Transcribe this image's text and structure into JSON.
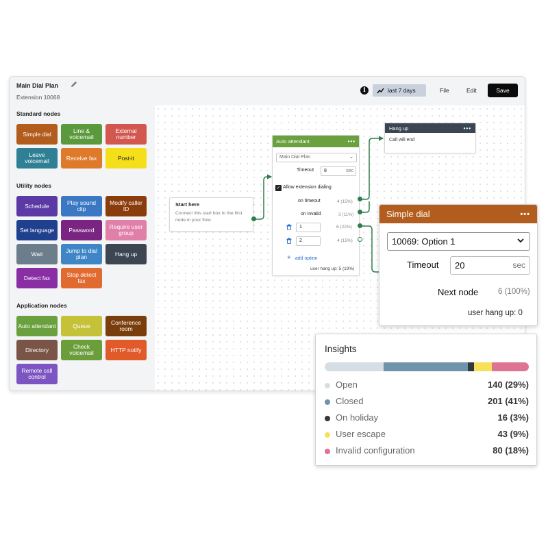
{
  "header": {
    "title": "Main Dial Plan",
    "subtitle": "Extension 10068",
    "range_label": "last 7 days",
    "menu_file": "File",
    "menu_edit": "Edit",
    "save_label": "Save"
  },
  "palette": {
    "standard_title": "Standard nodes",
    "utility_title": "Utility nodes",
    "application_title": "Application nodes",
    "standard": [
      {
        "label": "Simple dial",
        "color": "#b25d1d"
      },
      {
        "label": "Line & voicemail",
        "color": "#5b9a3c"
      },
      {
        "label": "External number",
        "color": "#d2584f"
      },
      {
        "label": "Leave voicemail",
        "color": "#2f7f95"
      },
      {
        "label": "Receive fax",
        "color": "#e07a2b"
      },
      {
        "label": "Post-it",
        "color": "#f4df1a",
        "text_color": "#222222"
      }
    ],
    "utility": [
      {
        "label": "Schedule",
        "color": "#5c3aa6"
      },
      {
        "label": "Play sound clip",
        "color": "#3a78c4"
      },
      {
        "label": "Modify caller ID",
        "color": "#8b3c0c"
      },
      {
        "label": "Set language",
        "color": "#1f3f8f"
      },
      {
        "label": "Password",
        "color": "#7a2582"
      },
      {
        "label": "Require user group",
        "color": "#e07fa8"
      },
      {
        "label": "Wait",
        "color": "#6c7e8c"
      },
      {
        "label": "Jump to dial plan",
        "color": "#3f86c6"
      },
      {
        "label": "Hang up",
        "color": "#3b4652"
      },
      {
        "label": "Detect fax",
        "color": "#8a2fa3"
      },
      {
        "label": "Stop detect fax",
        "color": "#e06a30"
      }
    ],
    "application": [
      {
        "label": "Auto attendant",
        "color": "#6aa13e"
      },
      {
        "label": "Queue",
        "color": "#c5c23a"
      },
      {
        "label": "Conference room",
        "color": "#7a3e0c"
      },
      {
        "label": "Directory",
        "color": "#7a5446"
      },
      {
        "label": "Check voicemail",
        "color": "#6b9e3a"
      },
      {
        "label": "HTTP notify",
        "color": "#e05a2a"
      },
      {
        "label": "Remote call control",
        "color": "#7d55c2"
      }
    ]
  },
  "flow": {
    "start": {
      "title": "Start here",
      "description": "Connect this start box to the first node in your flow."
    },
    "auto_attendant": {
      "title": "Auto attendant",
      "select_value": "Main Dial Plan",
      "timeout_label": "Timeout",
      "timeout_value": "8",
      "timeout_unit": "sec",
      "allow_ext_label": "Allow extension dialing",
      "on_timeout_label": "on timeout",
      "on_timeout_stat": "4 (15%)",
      "on_invalid_label": "on invalid",
      "on_invalid_stat": "3 (11%)",
      "options": [
        {
          "value": "1",
          "stat": "6 (22%)"
        },
        {
          "value": "2",
          "stat": "4 (15%)"
        }
      ],
      "add_option_label": "add option",
      "hang_up_stat": "user hang up: 5 (19%)"
    },
    "hang_up": {
      "title": "Hang up",
      "body": "Call will end"
    }
  },
  "simple_dial": {
    "title": "Simple dial",
    "select_value": "10069: Option 1",
    "timeout_label": "Timeout",
    "timeout_value": "20",
    "timeout_unit": "sec",
    "next_node_label": "Next node",
    "next_node_stat": "6 (100%)",
    "hang_up_stat": "user hang up: 0"
  },
  "insights": {
    "title": "Insights",
    "items": [
      {
        "label": "Open",
        "count": "140 (29%)",
        "share": 29,
        "color": "#d4dee3"
      },
      {
        "label": "Closed",
        "count": "201 (41%)",
        "share": 41,
        "color": "#6e93ab"
      },
      {
        "label": "On holiday",
        "count": "16 (3%)",
        "share": 3,
        "color": "#33383d"
      },
      {
        "label": "User escape",
        "count": "43 (9%)",
        "share": 9,
        "color": "#f5e15a"
      },
      {
        "label": "Invalid configuration",
        "count": "80 (18%)",
        "share": 18,
        "color": "#df7393"
      }
    ]
  },
  "icons": {
    "edit": "pencil-icon",
    "info": "info-icon",
    "range": "trend-icon",
    "delete": "trash-icon",
    "more": "more-dots-icon",
    "dropdown": "chevron-down-icon"
  }
}
